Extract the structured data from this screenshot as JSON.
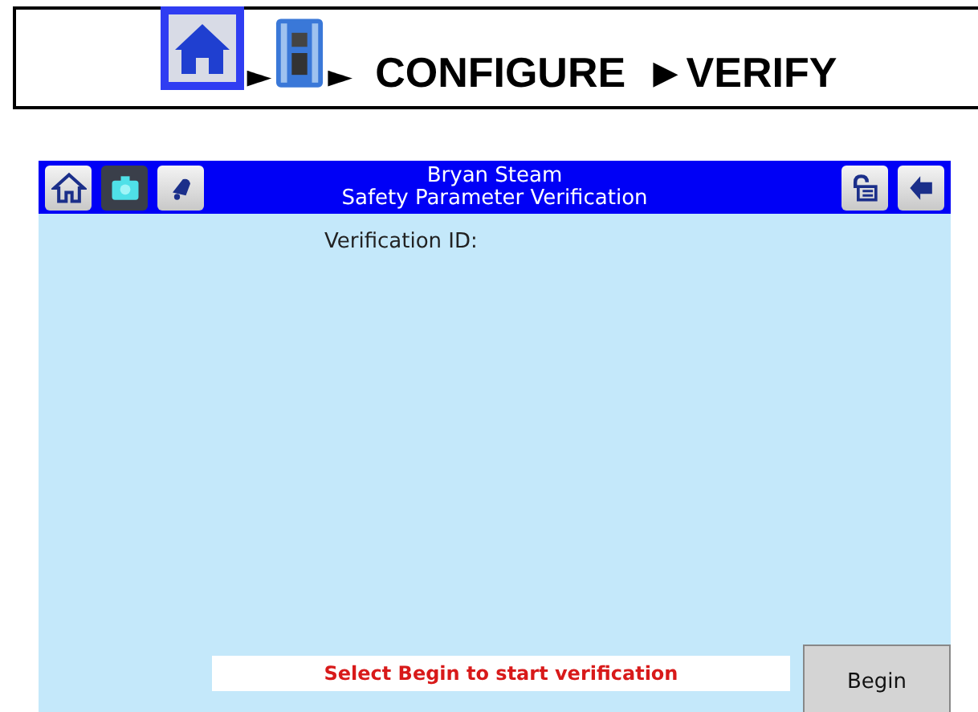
{
  "breadcrumb": {
    "arrow_1": "►",
    "arrow_2": "►",
    "step": "CONFIGURE",
    "last_step": "►VERIFY"
  },
  "header": {
    "title": "Bryan Steam",
    "subtitle": "Safety Parameter Verification"
  },
  "body": {
    "id_label": "Verification ID:"
  },
  "status_message": "Select Begin to start verification",
  "begin_button": "Begin"
}
